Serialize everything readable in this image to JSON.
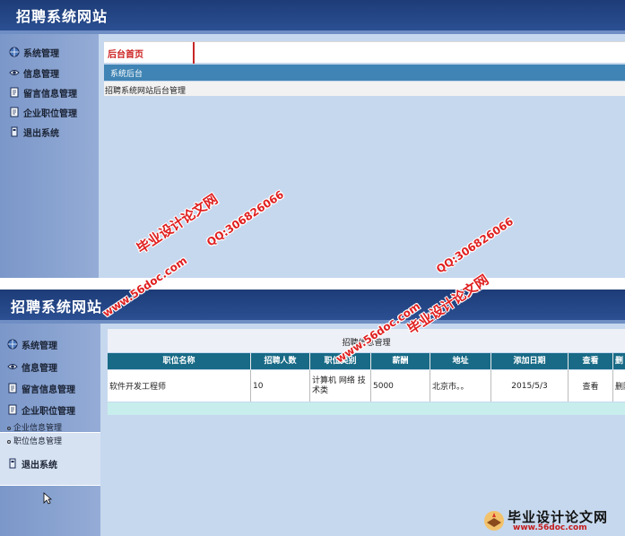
{
  "top": {
    "site_title": "招聘系统网站",
    "menu": [
      {
        "label": "系统管理",
        "icon": "globe-icon"
      },
      {
        "label": "信息管理",
        "icon": "eye-icon"
      },
      {
        "label": "留言信息管理",
        "icon": "document-icon"
      },
      {
        "label": "企业职位管理",
        "icon": "document-icon"
      },
      {
        "label": "退出系统",
        "icon": "exit-icon"
      }
    ],
    "tab_home": "后台首页",
    "crumb": "系统后台",
    "welcome": "招聘系统网站后台管理"
  },
  "bottom": {
    "site_title": "招聘系统网站",
    "menu": [
      {
        "label": "系统管理",
        "icon": "globe-icon"
      },
      {
        "label": "信息管理",
        "icon": "eye-icon"
      },
      {
        "label": "留言信息管理",
        "icon": "document-icon"
      },
      {
        "label": "企业职位管理",
        "icon": "document-icon"
      },
      {
        "label": "退出系统",
        "icon": "exit-icon"
      }
    ],
    "submenu": [
      "企业信息管理",
      "职位信息管理"
    ],
    "panel_title": "招聘信息管理",
    "table": {
      "columns": [
        "职位名称",
        "招聘人数",
        "职位类别",
        "薪酬",
        "地址",
        "添加日期",
        "查看",
        "删"
      ],
      "rows": [
        [
          "软件开发工程师",
          "10",
          "计算机 网络 技术类",
          "5000",
          "北京市。。",
          "2015/5/3",
          "查看",
          "删除"
        ]
      ]
    }
  },
  "watermarks": {
    "site_name": "毕业设计论文网",
    "url": "www.56doc.com",
    "qq": "QQ:306826066"
  },
  "logo": {
    "text": "毕业设计论文网",
    "url": "www.56doc.com"
  },
  "colors": {
    "header_blue": "#1d3c78",
    "sidebar_blue": "#7b97c9",
    "table_header": "#186a86",
    "tab_red": "#cc1f1f",
    "watermark_red": "#e02020"
  }
}
